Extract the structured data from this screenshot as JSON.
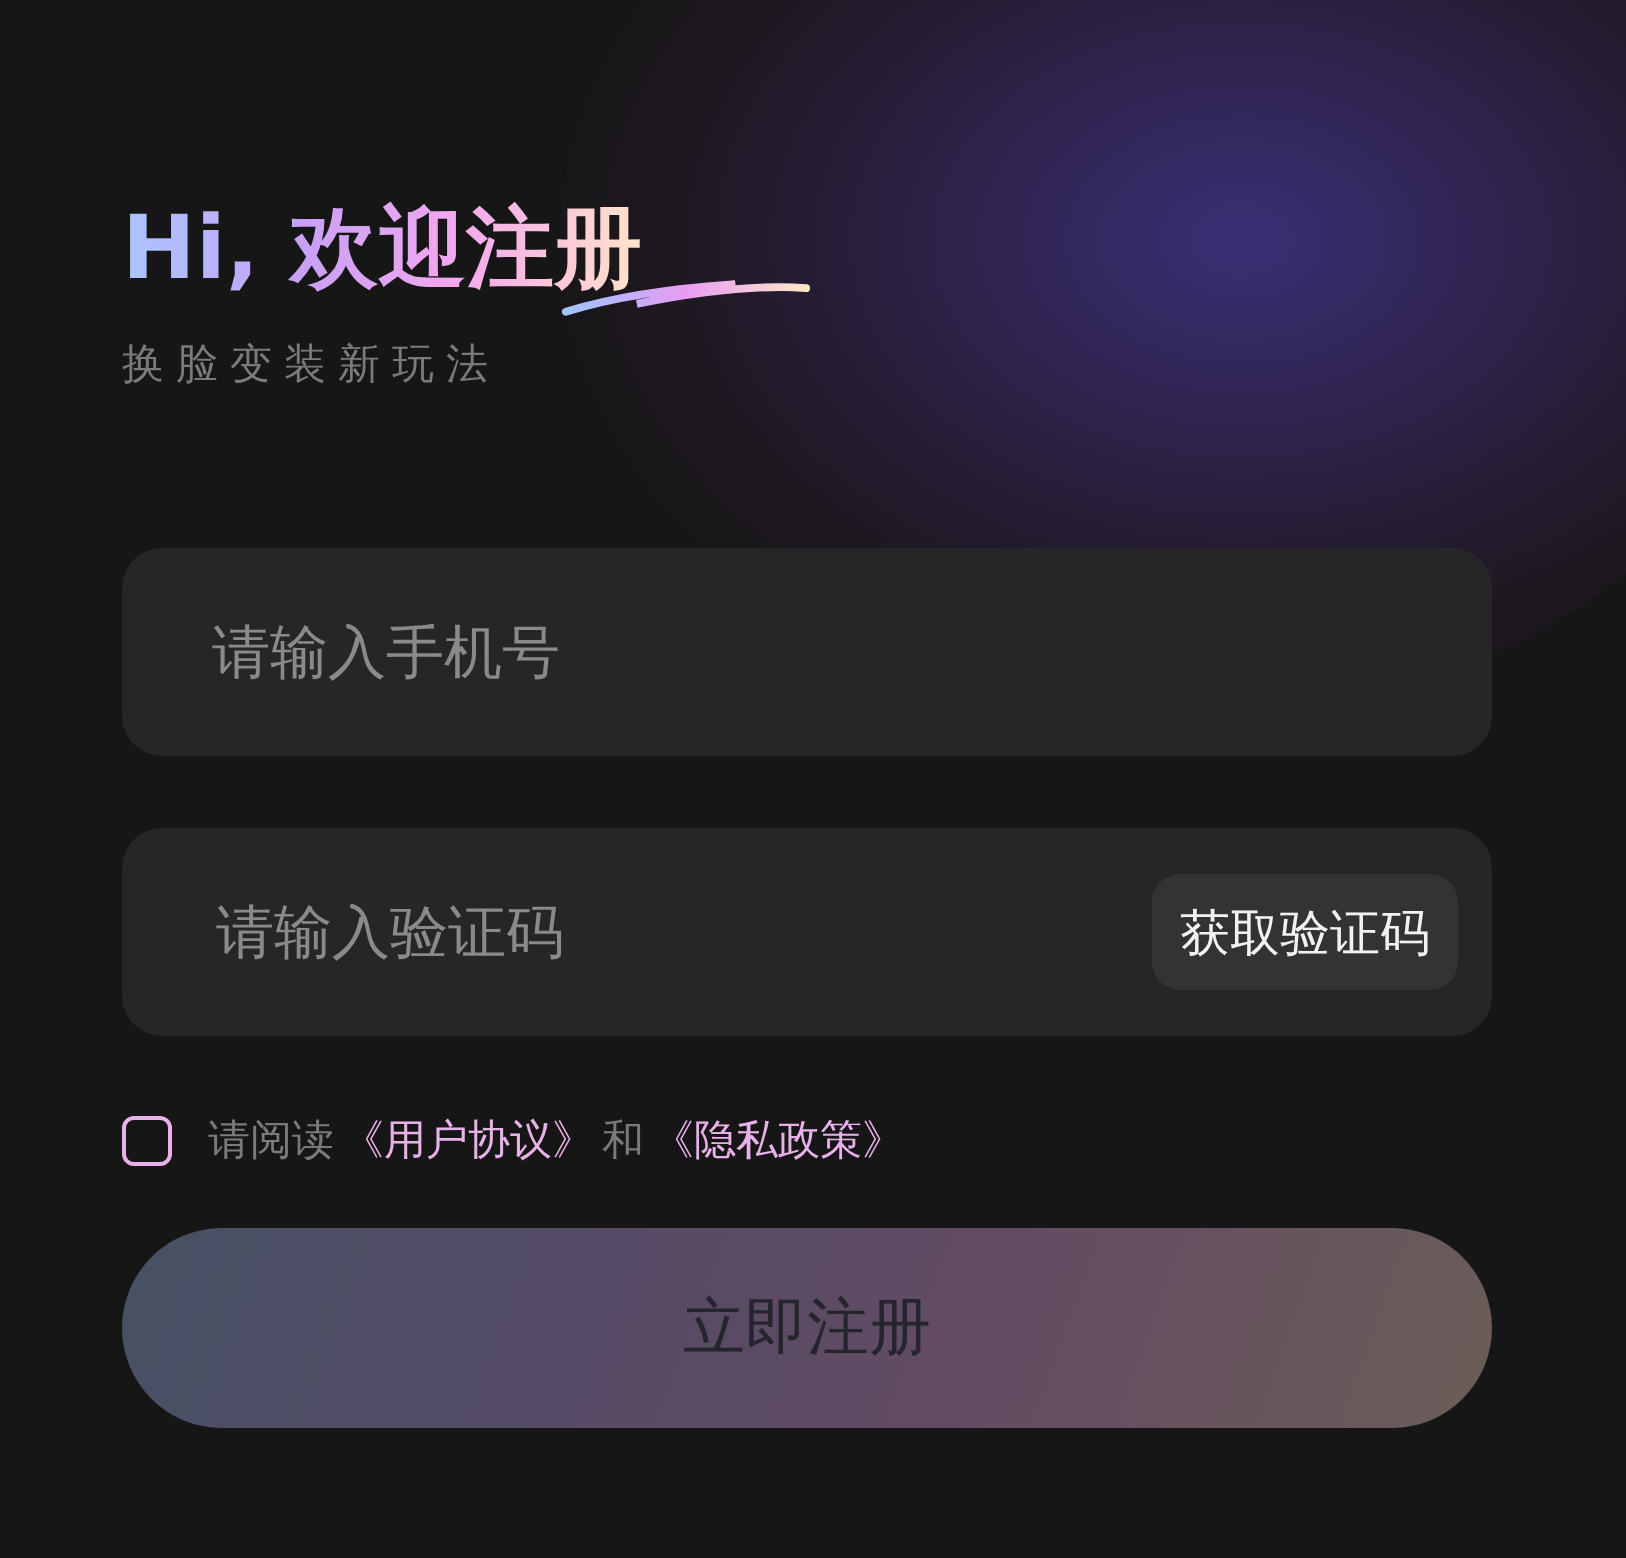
{
  "header": {
    "title": "Hi, 欢迎注册",
    "subtitle": "换脸变装新玩法"
  },
  "phone_field": {
    "placeholder": "请输入手机号"
  },
  "code_field": {
    "placeholder": "请输入验证码",
    "button": "获取验证码"
  },
  "agreement": {
    "checked": false,
    "parts": [
      {
        "text": "请阅读",
        "kind": "plain"
      },
      {
        "text": "《用户协议》",
        "kind": "link"
      },
      {
        "text": "和",
        "kind": "plain"
      },
      {
        "text": "《隐私政策》",
        "kind": "link"
      }
    ]
  },
  "submit": {
    "label": "立即注册",
    "disabled": true
  }
}
